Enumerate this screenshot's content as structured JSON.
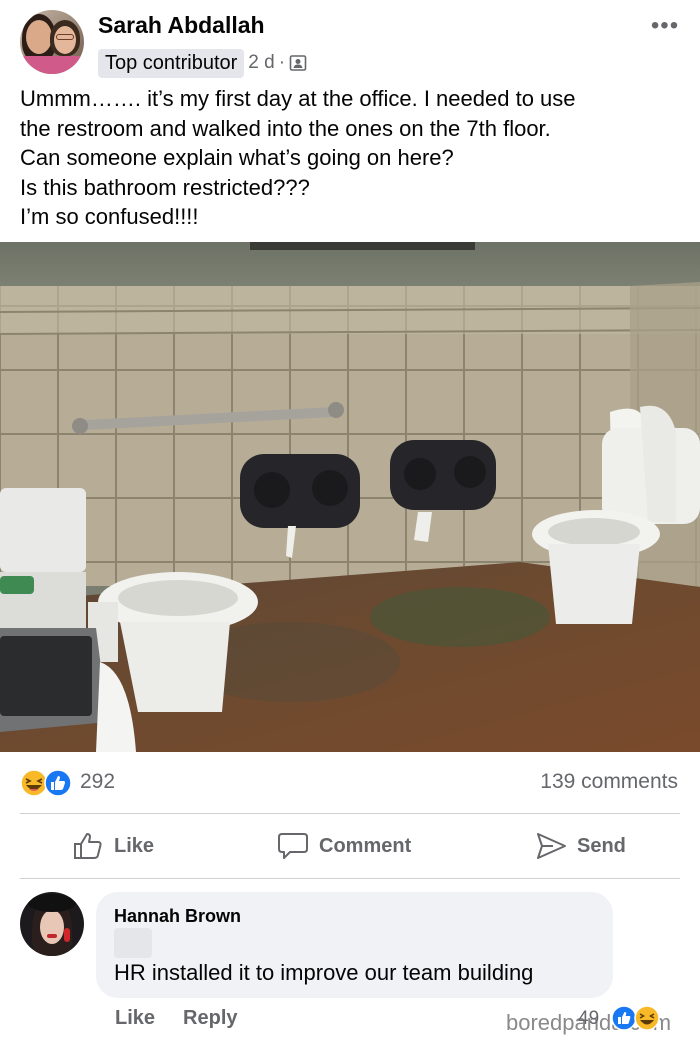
{
  "post": {
    "author": "Sarah Abdallah",
    "badge": "Top contributor",
    "time": "2 d",
    "separator": "·",
    "audience_icon": "friends-icon",
    "more_label": "•••",
    "text_lines": [
      "Ummm……. it’s my first day at the office. I needed to use",
      "the restroom and walked into the ones on the 7th floor.",
      "Can someone explain what’s going on here?",
      "Is this bathroom restricted???",
      "I’m so confused!!!!"
    ],
    "photo_caption_partial": "unknown"
  },
  "reactions": {
    "icons": [
      "haha-icon",
      "like-icon"
    ],
    "count": "292",
    "comments": "139 comments"
  },
  "actions": {
    "like": "Like",
    "comment": "Comment",
    "send": "Send"
  },
  "comment": {
    "author": "Hannah Brown",
    "text": "HR installed it to improve our team building",
    "like": "Like",
    "reply": "Reply",
    "reaction_count": "49",
    "reaction_icons": [
      "like-icon",
      "haha-icon"
    ]
  },
  "watermark": "boredpanda.com",
  "colors": {
    "text": "#050505",
    "secondary": "#65676b",
    "bubble": "#f0f2f5",
    "like_blue": "#1877f2",
    "haha_yellow": "#f7b928"
  }
}
